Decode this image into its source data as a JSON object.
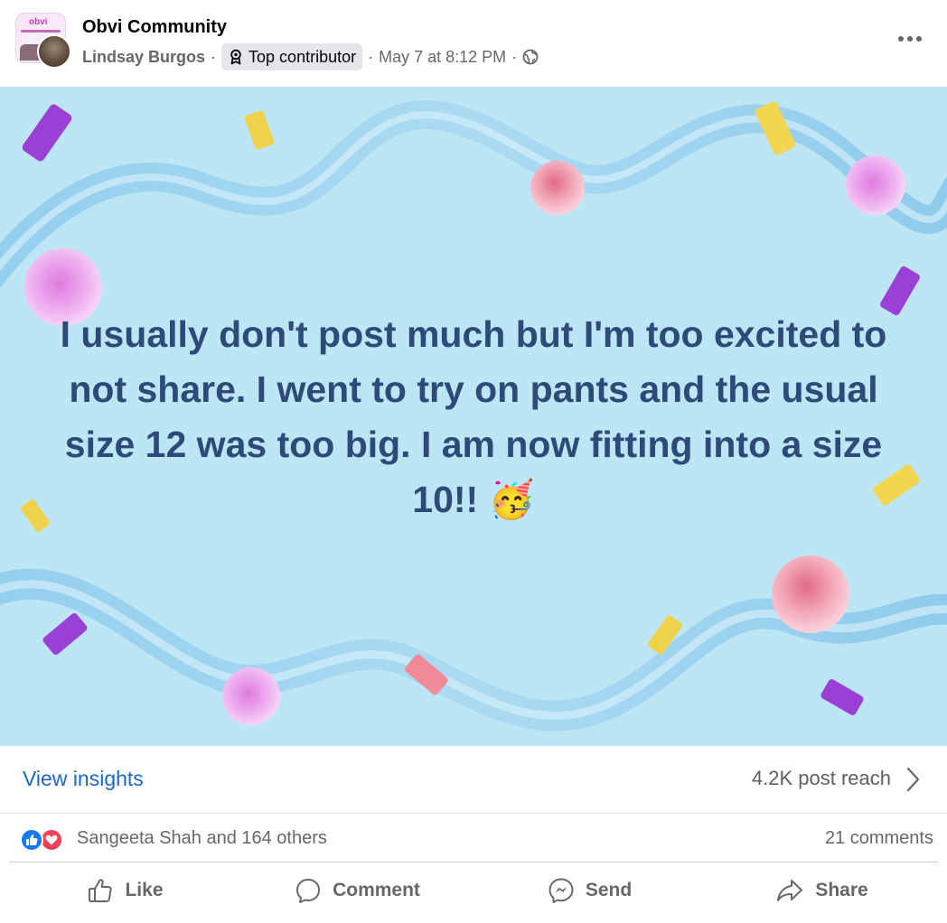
{
  "header": {
    "group_name": "Obvi Community",
    "author": "Lindsay Burgos",
    "separator": "·",
    "badge_label": "Top contributor",
    "timestamp": "May 7 at 8:12 PM",
    "group_avatar_logo": "obvi",
    "privacy_icon": "globe-icon",
    "more_icon": "more-icon"
  },
  "post": {
    "text": "I usually don't post much but I'm too excited to not share. I went to try on pants and the usual size 12 was too big. I am now fitting into a size 10!!",
    "emoji": "🥳",
    "background_color": "#bde6f5",
    "text_color": "#2e4a78"
  },
  "insights": {
    "view_label": "View insights",
    "reach_label": "4.2K post reach"
  },
  "reactions": {
    "icons": [
      "like-icon",
      "love-icon"
    ],
    "names": "Sangeeta Shah and 164 others",
    "comments": "21 comments"
  },
  "actions": [
    {
      "label": "Like",
      "icon": "thumbs-up-icon"
    },
    {
      "label": "Comment",
      "icon": "comment-icon"
    },
    {
      "label": "Send",
      "icon": "messenger-icon"
    },
    {
      "label": "Share",
      "icon": "share-icon"
    }
  ],
  "colors": {
    "link_blue": "#1b66c9",
    "like_blue": "#1877f2",
    "love_red": "#f33e58",
    "muted_text": "#65676b"
  }
}
